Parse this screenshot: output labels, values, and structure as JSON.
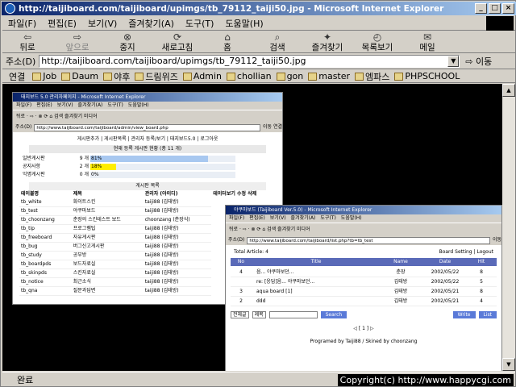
{
  "window": {
    "title": "http://taijiboard.com/taijiboard/upimgs/tb_79112_taiji50.jpg - Microsoft Internet Explorer",
    "controls": [
      "_",
      "□",
      "×"
    ]
  },
  "menu": [
    "파일(F)",
    "편집(E)",
    "보기(V)",
    "즐겨찾기(A)",
    "도구(T)",
    "도움말(H)"
  ],
  "toolbar": [
    {
      "label": "뒤로",
      "icon": "back-arrow-icon",
      "glyph": "⇦",
      "disabled": false
    },
    {
      "label": "앞으로",
      "icon": "forward-arrow-icon",
      "glyph": "⇨",
      "disabled": true
    },
    {
      "label": "중지",
      "icon": "stop-icon",
      "glyph": "⊗",
      "disabled": false
    },
    {
      "label": "새로고침",
      "icon": "refresh-icon",
      "glyph": "⟳",
      "disabled": false
    },
    {
      "label": "홈",
      "icon": "home-icon",
      "glyph": "⌂",
      "disabled": false
    },
    {
      "label": "검색",
      "icon": "search-icon",
      "glyph": "⌕",
      "disabled": false
    },
    {
      "label": "즐겨찾기",
      "icon": "favorites-icon",
      "glyph": "✦",
      "disabled": false
    },
    {
      "label": "목록보기",
      "icon": "history-icon",
      "glyph": "◴",
      "disabled": false
    },
    {
      "label": "메일",
      "icon": "mail-icon",
      "glyph": "✉",
      "disabled": false
    }
  ],
  "address": {
    "label": "주소(D)",
    "url": "http://taijiboard.com/taijiboard/upimgs/tb_79112_taiji50.jpg",
    "go": "이동"
  },
  "links": {
    "label": "연결",
    "items": [
      "Job",
      "Daum",
      "야후",
      "드림위즈",
      "Admin",
      "chollian",
      "gon",
      "master",
      "엠파스",
      "PHPSCHOOL"
    ]
  },
  "status": {
    "text": "완료",
    "copyright": "Copyright(c) http://www.happycgi.com"
  },
  "inner1": {
    "title": "태지보드 5.0 관리자페이지 - Microsoft Internet Explorer",
    "menu": [
      "파일(F)",
      "편집(E)",
      "보기(V)",
      "즐겨찾기(A)",
      "도구(T)",
      "도움말(H)"
    ],
    "toolbar": "뒤로 · ⇨ · ⊗ ⟳ ⌂ 검색 즐겨찾기 미디어",
    "address_label": "주소(D)",
    "url": "http://www.taijiboard.com/taijiboard/admin/view_board.php",
    "go": "이동",
    "links_label": "연결",
    "nav": "게시판추가 | 게시판목록 | 관리자 등록/보기 | 태지보드5.0 | 로그아웃",
    "status_header": "현재 등록 게시판 현황 (총 11 개)",
    "stats": [
      {
        "name": "일반게시판",
        "count": "9 개",
        "pct_label": "81%",
        "pct": 81,
        "color": "#a8c8f0"
      },
      {
        "name": "공지사항",
        "count": "2 개",
        "pct_label": "18%",
        "pct": 18,
        "color": "#ffee00"
      },
      {
        "name": "익명게시판",
        "count": "0 개",
        "pct_label": "0%",
        "pct": 0,
        "color": "#ff8888"
      }
    ],
    "list_header": "게시판 목록",
    "columns": [
      "테이블명",
      "제목",
      "관리자 (아이디)",
      "테이터보기 수정 삭제"
    ],
    "rows": [
      [
        "tb_white",
        "화이트스킨",
        "taiji88 (김태방)"
      ],
      [
        "tb_test",
        "야쿠마보드",
        "taiji88 (김태방)"
      ],
      [
        "tb_choonzang",
        "춘장의 스킨테스트 보드",
        "choonzang (춘장식)"
      ],
      [
        "tb_tip",
        "프로그램팁",
        "taiji88 (김태방)"
      ],
      [
        "tb_freeboard",
        "자유게시판",
        "taiji88 (김태방)"
      ],
      [
        "tb_bug",
        "버그신고게시판",
        "taiji88 (김태방)"
      ],
      [
        "tb_study",
        "공부방",
        "taiji88 (김태방)"
      ],
      [
        "tb_boardpds",
        "보드자료실",
        "taiji88 (김태방)"
      ],
      [
        "tb_skinpds",
        "스킨자료실",
        "taiji88 (김태방)"
      ],
      [
        "tb_notice",
        "최근소식",
        "taiji88 (김태방)"
      ],
      [
        "tb_qna",
        "질문과답변",
        "taiji88 (김태방)"
      ]
    ]
  },
  "inner2": {
    "title": "야쿠마보드 (Taijiboard Ver.5.0) - Microsoft Internet Explorer",
    "menu": [
      "파일(F)",
      "편집(E)",
      "보기(V)",
      "즐겨찾기(A)",
      "도구(T)",
      "도움말(H)"
    ],
    "toolbar": "뒤로 · ⇨ · ⊗ ⟳ ⌂ 검색 즐겨찾기 미디어",
    "address_label": "주소(D)",
    "url": "http://www.taijiboard.com/taijiboard/list.php?tb=tb_test",
    "go": "이동",
    "total": "Total Article: 4",
    "board_links": "Board Setting | Logout",
    "columns": [
      "No",
      "Title",
      "Name",
      "Date",
      "Hit"
    ],
    "rows": [
      [
        "4",
        "음... 야쿠마보던...",
        "춘장",
        "2002/05/22",
        "8"
      ],
      [
        "",
        "re: [응답]음... 야쿠마보던...",
        "김태방",
        "2002/05/22",
        "5"
      ],
      [
        "3",
        "aqua board [1]",
        "김태방",
        "2002/05/21",
        "8"
      ],
      [
        "2",
        "ddd",
        "김태방",
        "2002/05/21",
        "4"
      ]
    ],
    "search_scope": "전체글",
    "search_field": "제목",
    "search_button": "Search",
    "write_button": "Write",
    "list_button": "List",
    "paging": "◁ [ 1 ] ▷",
    "footer": "Programed by Taiji88 / Skined by choonzang"
  }
}
